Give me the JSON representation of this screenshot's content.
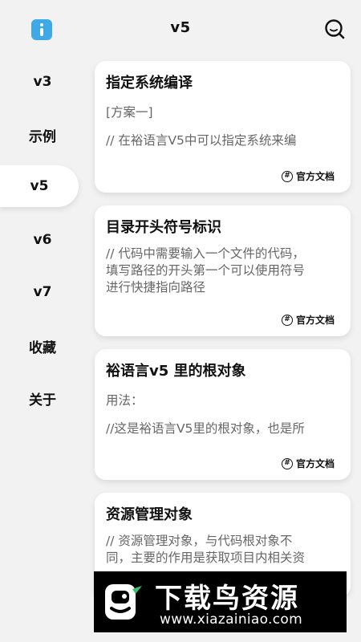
{
  "header": {
    "title": "v5",
    "info_icon": "info-icon",
    "search_icon": "search-icon"
  },
  "sidebar": {
    "items": [
      {
        "label": "v3",
        "active": false
      },
      {
        "label": "示例",
        "active": false
      },
      {
        "label": "v5",
        "active": true
      },
      {
        "label": "v6",
        "active": false
      },
      {
        "label": "v7",
        "active": false
      },
      {
        "label": "收藏",
        "active": false
      },
      {
        "label": "关于",
        "active": false
      }
    ]
  },
  "cards": [
    {
      "title": "指定系统编译",
      "lines": [
        "[方案一]",
        "",
        "// 在裕语言V5中可以指定系统来编"
      ],
      "footer": "官方文档"
    },
    {
      "title": "目录开头符号标识",
      "lines": [
        "// 代码中需要输入一个文件的代码，",
        "填写路径的开头第一个可以使用符号",
        "进行快捷指向路径"
      ],
      "footer": "官方文档"
    },
    {
      "title": "裕语言v5 里的根对象",
      "lines": [
        "用法：",
        "",
        "//这是裕语言V5里的根对象，也是所"
      ],
      "footer": "官方文档"
    },
    {
      "title": "资源管理对象",
      "lines": [
        "// 资源管理对象，与代码根对象不",
        "同，主要的作用是获取项目内相关资"
      ],
      "footer": ""
    }
  ],
  "banner": {
    "title": "下载鸟资源",
    "url": "www.xiazainiao.com"
  },
  "colors": {
    "accent": "#3fa9e8",
    "background": "#f2f2f2",
    "card": "#ffffff"
  }
}
